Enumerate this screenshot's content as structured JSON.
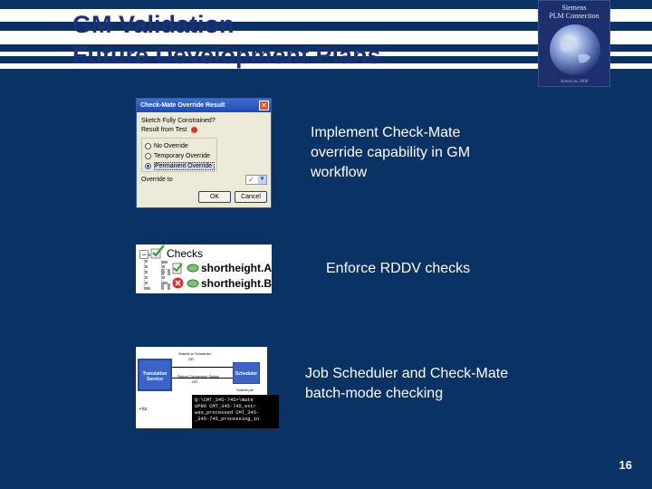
{
  "slide": {
    "title_line1": "GM Validation",
    "title_line2": "Future Development Plans",
    "page_number": "16"
  },
  "logo": {
    "line1": "Siemens",
    "line2": "PLM Connection",
    "date": "Americas 2008"
  },
  "bullets": [
    {
      "text": "Implement Check-Mate override capability in GM workflow"
    },
    {
      "text": "Enforce RDDV checks"
    },
    {
      "text": "Job Scheduler and Check-Mate batch-mode checking"
    }
  ],
  "dialog": {
    "title": "Check-Mate Override Result",
    "close": "✕",
    "question": "Sketch Fully Constrained?",
    "result_label": "Result from Test",
    "options": [
      "No Override",
      "Temporary Override",
      "Permanent Override"
    ],
    "selected_option": 2,
    "override_to_label": "Override to",
    "ok_label": "OK",
    "cancel_label": "Cancel"
  },
  "tree": {
    "expander": "−",
    "root_label": "Checks",
    "items": [
      {
        "label": "shortheight.A",
        "status": "pass"
      },
      {
        "label": "shortheight.B",
        "status": "fail"
      }
    ]
  },
  "diagram": {
    "translation_box": "Translation Service",
    "scheduler_box": "Scheduler",
    "label_submit_top": "Submit to Scheduler",
    "label_submit_sub": "OR",
    "label_status": "Return Conversion Status",
    "label_status_sub": "OR",
    "label_submit_right": "Submit job",
    "label_ko": "• ko",
    "terminal_lines": [
      "Q:\\CMT_345-745>\\mate",
      "UPRO CMT_345-745_extr",
      "was_processed CMT_345-",
      "_345-745_processing_in"
    ]
  },
  "colors": {
    "background": "#0a3264",
    "header_stripe": "#0a3264",
    "title_text": "#1e2f78",
    "body_text": "#ffffff"
  }
}
